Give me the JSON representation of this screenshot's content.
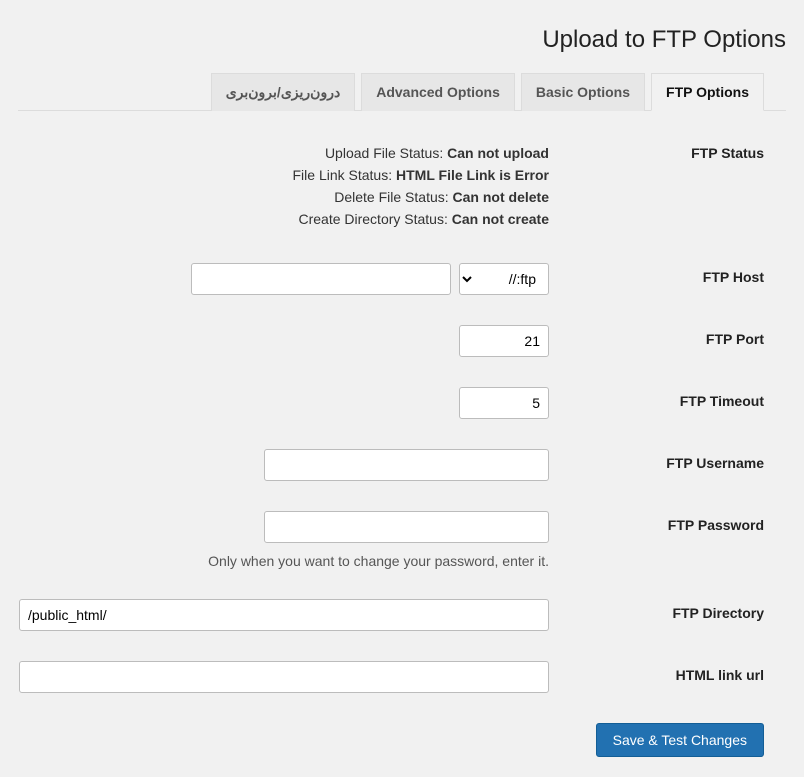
{
  "header": {
    "title": "Upload to FTP Options"
  },
  "tabs": [
    {
      "label": "FTP Options",
      "active": true
    },
    {
      "label": "Basic Options",
      "active": false
    },
    {
      "label": "Advanced Options",
      "active": false
    },
    {
      "label": "درون‌ریزی/برون‌بری",
      "active": false
    }
  ],
  "status": {
    "label": "FTP Status",
    "upload_label": "Upload File Status: ",
    "upload_value": "Can not upload",
    "link_label": "File Link Status: ",
    "link_value": "HTML File Link is Error",
    "delete_label": "Delete File Status: ",
    "delete_value": "Can not delete",
    "dir_label": "Create Directory Status: ",
    "dir_value": "Can not create"
  },
  "host": {
    "label": "FTP Host",
    "protocol_selected": "ftp://",
    "value": ""
  },
  "port": {
    "label": "FTP Port",
    "value": "21"
  },
  "timeout": {
    "label": "FTP Timeout",
    "value": "5"
  },
  "username": {
    "label": "FTP Username",
    "value": ""
  },
  "password": {
    "label": "FTP Password",
    "value": "",
    "hint": ".Only when you want to change your password, enter it"
  },
  "directory": {
    "label": "FTP Directory",
    "value": "/public_html/"
  },
  "linkurl": {
    "label": "HTML link url",
    "value": ""
  },
  "buttons": {
    "submit": "Save & Test Changes"
  }
}
